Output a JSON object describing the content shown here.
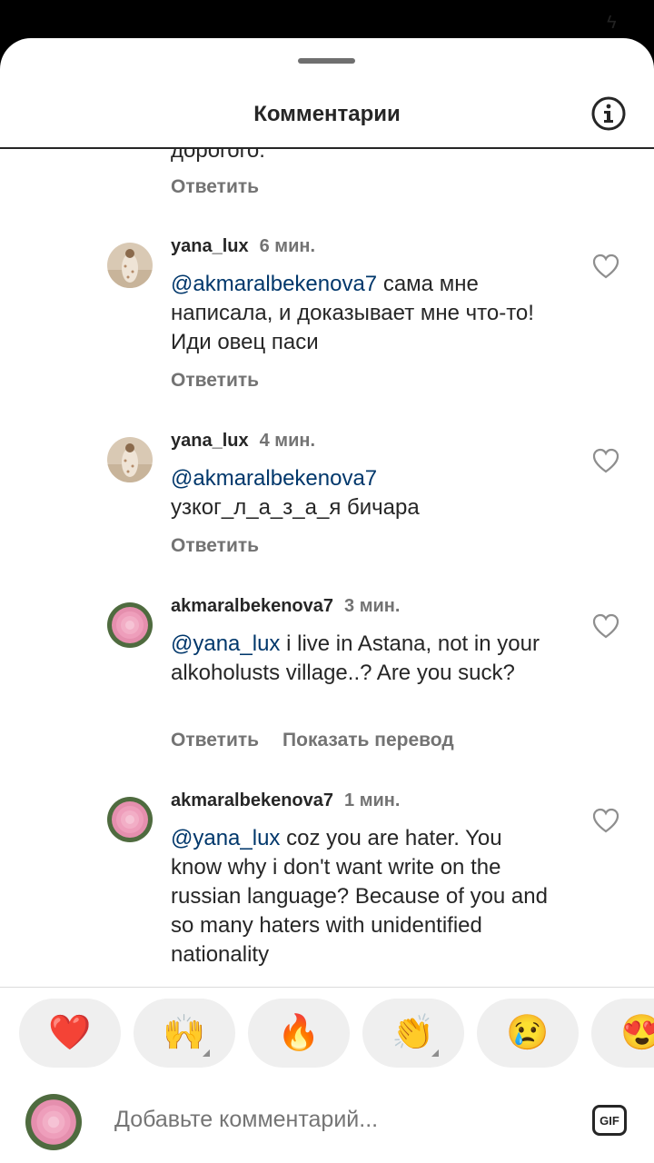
{
  "header": {
    "title": "Комментарии"
  },
  "partial": {
    "text": "дорогого.",
    "reply": "Ответить"
  },
  "comments": [
    {
      "user": "yana_lux",
      "time": "6 мин.",
      "mention": "@akmaralbekenova7",
      "text": " сама мне написала, и доказывает мне что-то! Иди овец паси",
      "reply": "Ответить",
      "avatar": "photo"
    },
    {
      "user": "yana_lux",
      "time": "4 мин.",
      "mention": "@akmaralbekenova7",
      "text": " узког_л_а_з_а_я  бичара",
      "reply": "Ответить",
      "avatar": "photo"
    },
    {
      "user": "akmaralbekenova7",
      "time": "3 мин.",
      "mention": "@yana_lux",
      "text": " i live in Astana, not in your alkoholusts village..? Are you suck?",
      "reply": "Ответить",
      "translate": "Показать перевод",
      "avatar": "flower"
    },
    {
      "user": "akmaralbekenova7",
      "time": "1 мин.",
      "mention": "@yana_lux",
      "text": " coz you are hater. You know why i don't want write on the russian language? Because of you and so many haters with unidentified nationality",
      "avatar": "flower"
    }
  ],
  "reactions": [
    "❤️",
    "🙌",
    "🔥",
    "👏",
    "😢",
    "😍"
  ],
  "composer": {
    "placeholder": "Добавьте комментарий...",
    "gif_label": "GIF"
  },
  "colors": {
    "mention": "#00376b",
    "secondary": "#737373",
    "reaction_bg": "#efefef"
  }
}
